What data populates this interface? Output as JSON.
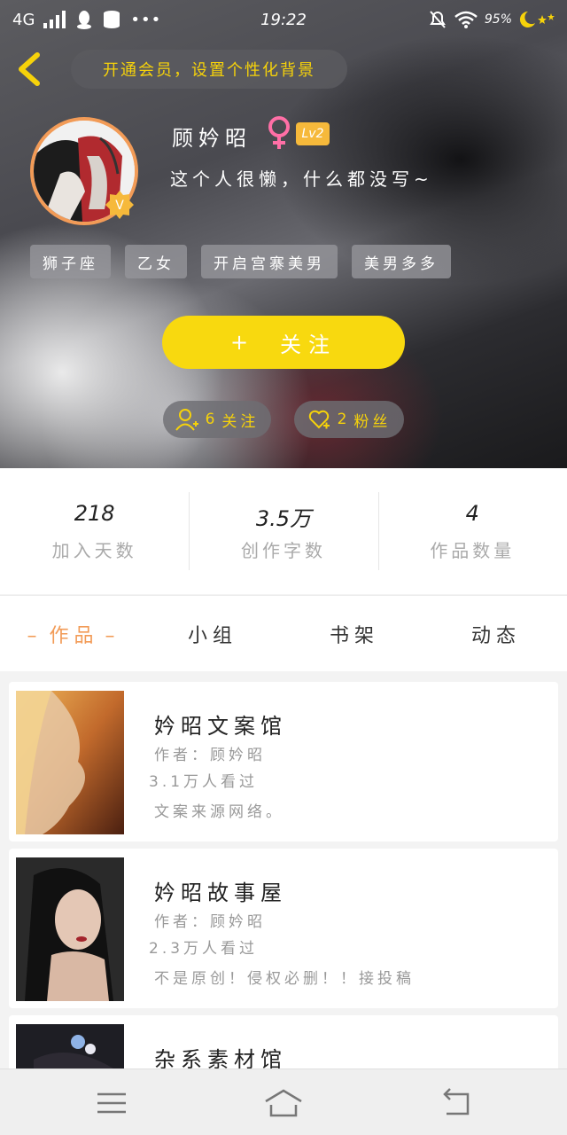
{
  "status_bar": {
    "network": "4G",
    "time": "19:22",
    "battery": "95%",
    "icons": [
      "signal-icon",
      "qq-icon",
      "storage-icon",
      "more-dots-icon",
      "mute-icon",
      "wifi-icon",
      "moon-stars-icon"
    ]
  },
  "header": {
    "background_pill": "开通会员，设置个性化背景"
  },
  "profile": {
    "name": "顾妗昭",
    "gender_icon": "female-icon",
    "level": "Lv2",
    "bio": "这个人很懒，什么都没写~",
    "vip_badge": "V",
    "tags": [
      "狮子座",
      "乙女",
      "开启宫寨美男",
      "美男多多"
    ]
  },
  "actions": {
    "follow_label": "关注",
    "follow_plus": "+",
    "following_count": "6",
    "following_label": "关注",
    "followers_count": "2",
    "followers_label": "粉丝"
  },
  "stats": [
    {
      "value": "218",
      "label": "加入天数"
    },
    {
      "value": "3.5万",
      "label": "创作字数"
    },
    {
      "value": "4",
      "label": "作品数量"
    }
  ],
  "tabs": [
    {
      "label": "作品",
      "active": true
    },
    {
      "label": "小组",
      "active": false
    },
    {
      "label": "书架",
      "active": false
    },
    {
      "label": "动态",
      "active": false
    }
  ],
  "works": [
    {
      "title": "妗昭文案馆",
      "author": "作者：顾妗昭",
      "views": "3.1万人看过",
      "desc": "文案来源网络。"
    },
    {
      "title": "妗昭故事屋",
      "author": "作者：顾妗昭",
      "views": "2.3万人看过",
      "desc": "不是原创！侵权必删！！接投稿"
    },
    {
      "title": "杂系素材馆",
      "author": "",
      "views": "",
      "desc": ""
    }
  ],
  "colors": {
    "accent_yellow": "#f8d90f",
    "accent_orange": "#f29b57",
    "level_badge": "#f6b93b"
  }
}
